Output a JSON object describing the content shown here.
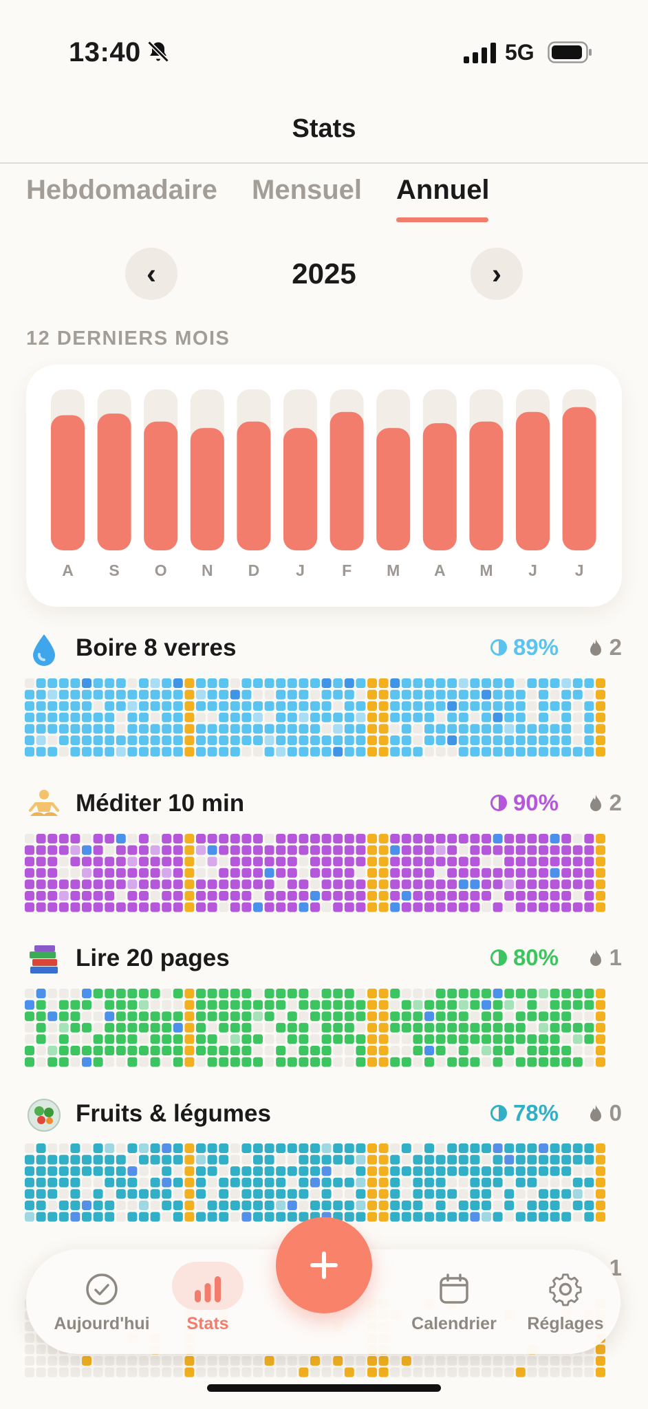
{
  "status_bar": {
    "time": "13:40",
    "network": "5G"
  },
  "nav": {
    "title": "Stats"
  },
  "tabs": [
    {
      "label": "Hebdomadaire",
      "active": false
    },
    {
      "label": "Mensuel",
      "active": false
    },
    {
      "label": "Annuel",
      "active": true
    }
  ],
  "year_selector": {
    "year": "2025",
    "prev": "‹",
    "next": "›"
  },
  "section_label": "12 DERNIERS MOIS",
  "colors": {
    "accent": "#F27D6C",
    "bar_track": "#F3EDE7",
    "empty_cell": "#EFEBE6",
    "current_week": "#F2B01E"
  },
  "chart_data": {
    "type": "bar",
    "categories": [
      "A",
      "S",
      "O",
      "N",
      "D",
      "J",
      "F",
      "M",
      "A",
      "M",
      "J",
      "J"
    ],
    "values": [
      84,
      85,
      80,
      76,
      80,
      76,
      86,
      76,
      79,
      80,
      86,
      89
    ],
    "ylim": [
      0,
      100
    ],
    "title": "",
    "xlabel": "",
    "ylabel": ""
  },
  "habits": [
    {
      "emoji": "water-drop-icon",
      "name": "Boire 8 verres",
      "pct": "89%",
      "streak": "2",
      "color": "#5AC3F0",
      "alt": "#3F94E8",
      "light": "#A9DDF4",
      "fill_rate": 0.89
    },
    {
      "emoji": "meditation-icon",
      "name": "Méditer 10 min",
      "pct": "90%",
      "streak": "2",
      "color": "#B457DB",
      "alt": "#4B90EA",
      "light": "#D6A9EC",
      "fill_rate": 0.9
    },
    {
      "emoji": "books-icon",
      "name": "Lire 20 pages",
      "pct": "80%",
      "streak": "1",
      "color": "#3CC460",
      "alt": "#4B90EA",
      "light": "#A6E2B7",
      "fill_rate": 0.8
    },
    {
      "emoji": "salad-icon",
      "name": "Fruits & légumes",
      "pct": "78%",
      "streak": "0",
      "color": "#30AFC6",
      "alt": "#5590E8",
      "light": "#9FD8E2",
      "fill_rate": 0.78
    },
    {
      "emoji": "habit-icon",
      "name": "",
      "pct": "",
      "streak": "1",
      "color": "#F0B020",
      "alt": "#F0B020",
      "light": "#F6D890",
      "fill_rate": 0.05
    }
  ],
  "tabbar": {
    "today": "Aujourd'hui",
    "stats": "Stats",
    "add": "+",
    "calendar": "Calendrier",
    "settings": "Réglages"
  }
}
